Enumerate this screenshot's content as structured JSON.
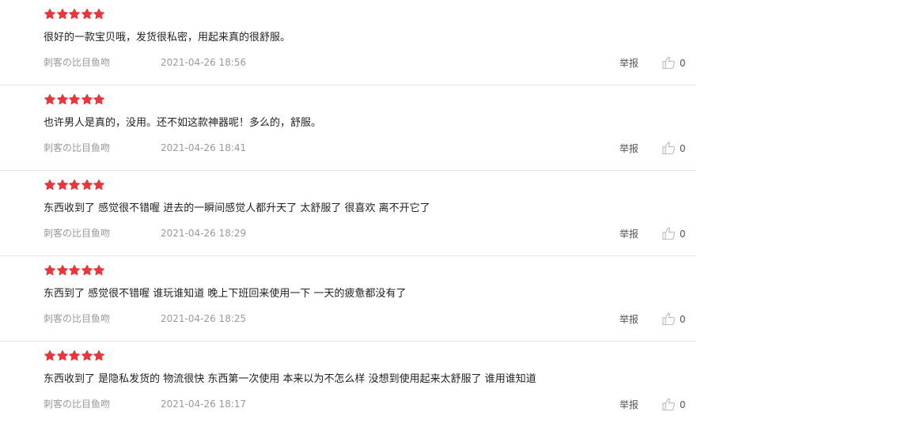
{
  "colors": {
    "star": "#e8363b",
    "text": "#222222",
    "meta": "#999999",
    "divider": "#e3e3e3"
  },
  "reviews": [
    {
      "rating": 5,
      "content": "很好的一款宝贝哦，发货很私密，用起来真的很舒服。",
      "author": "刺客の比目鱼吻",
      "date": "2021-04-26 18:56",
      "report_label": "举报",
      "like_icon": "thumbs-up-icon",
      "likes": "0"
    },
    {
      "rating": 5,
      "content": "也许男人是真的，没用。还不如这款神器呢！多么的，舒服。",
      "author": "刺客の比目鱼吻",
      "date": "2021-04-26 18:41",
      "report_label": "举报",
      "like_icon": "thumbs-up-icon",
      "likes": "0"
    },
    {
      "rating": 5,
      "content": "东西收到了 感觉很不错喔 进去的一瞬间感觉人都升天了 太舒服了 很喜欢 离不开它了",
      "author": "刺客の比目鱼吻",
      "date": "2021-04-26 18:29",
      "report_label": "举报",
      "like_icon": "thumbs-up-icon",
      "likes": "0"
    },
    {
      "rating": 5,
      "content": "东西到了 感觉很不错喔 谁玩谁知道 晚上下班回来使用一下 一天的疲惫都没有了",
      "author": "刺客の比目鱼吻",
      "date": "2021-04-26 18:25",
      "report_label": "举报",
      "like_icon": "thumbs-up-icon",
      "likes": "0"
    },
    {
      "rating": 5,
      "content": "东西收到了 是隐私发货的 物流很快 东西第一次使用 本来以为不怎么样 没想到使用起来太舒服了 谁用谁知道",
      "author": "刺客の比目鱼吻",
      "date": "2021-04-26 18:17",
      "report_label": "举报",
      "like_icon": "thumbs-up-icon",
      "likes": "0"
    }
  ]
}
